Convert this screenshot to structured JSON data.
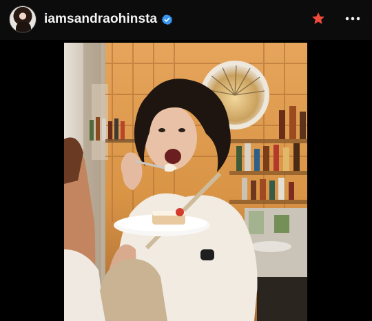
{
  "post_header": {
    "username": "iamsandraohinsta",
    "verified": true,
    "icons": {
      "avatar": "profile-avatar",
      "verified": "verified-badge-icon",
      "favorite": "star-icon",
      "more": "more-options-icon"
    }
  },
  "colors": {
    "header_bg": "#0c0c0c",
    "verified_blue": "#3897f0",
    "star_red": "#ef4b3c"
  },
  "photo": {
    "scene": "woman eating cake at a bar"
  }
}
